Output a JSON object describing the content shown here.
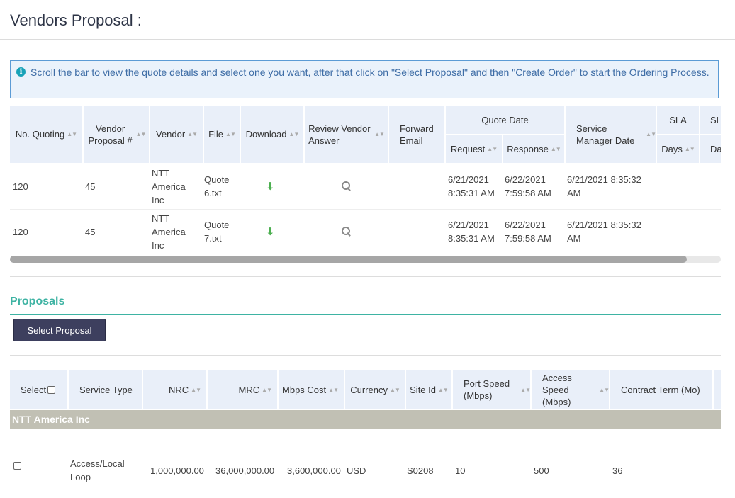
{
  "page": {
    "title": "Vendors Proposal :"
  },
  "info": {
    "icon": "info-icon",
    "message": "Scroll the bar to view the quote details and select one you want, after that click on \"Select Proposal\" and then \"Create Order\" to start the Ordering Process."
  },
  "quotes": {
    "headers": {
      "no_quoting": "No. Quoting",
      "vendor_proposal": "Vendor Proposal #",
      "vendor": "Vendor",
      "file": "File",
      "download": "Download",
      "review": "Review Vendor Answer",
      "forward_email": "Forward Email",
      "quote_date": "Quote Date",
      "request": "Request",
      "response": "Response",
      "service_manager_date": "Service Manager Date",
      "sla": "SLA",
      "sla_days": "Days",
      "sla2": "SL",
      "sla2_days": "Da"
    },
    "rows": [
      {
        "no_quoting": "120",
        "vendor_proposal": "45",
        "vendor": "NTT America Inc",
        "file": "Quote 6.txt",
        "request": "6/21/2021 8:35:31 AM",
        "response": "6/22/2021 7:59:58 AM",
        "service_manager_date": "6/21/2021 8:35:32 AM"
      },
      {
        "no_quoting": "120",
        "vendor_proposal": "45",
        "vendor": "NTT America Inc",
        "file": "Quote 7.txt",
        "request": "6/21/2021 8:35:31 AM",
        "response": "6/22/2021 7:59:58 AM",
        "service_manager_date": "6/21/2021 8:35:32 AM"
      }
    ]
  },
  "proposals": {
    "title": "Proposals",
    "select_button": "Select Proposal",
    "headers": {
      "select": "Select",
      "service_type": "Service Type",
      "nrc": "NRC",
      "mrc": "MRC",
      "mbps_cost": "Mbps Cost",
      "currency": "Currency",
      "site_id": "Site Id",
      "port_speed": "Port Speed (Mbps)",
      "access_speed": "Access Speed (Mbps)",
      "contract_term": "Contract Term (Mo)"
    },
    "group": "NTT America Inc",
    "rows": [
      {
        "service_type": "Access/Local Loop",
        "nrc": "1,000,000.00",
        "mrc": "36,000,000.00",
        "mbps_cost": "3,600,000.00",
        "currency": "USD",
        "site_id": "S0208",
        "port_speed": "10",
        "access_speed": "500",
        "contract_term": "36"
      }
    ]
  },
  "colors": {
    "header_bg": "#e9eff9",
    "accent_teal": "#3eb3a3",
    "button_bg": "#3d3f5e",
    "group_bg": "#c1c0b4",
    "download_green": "#4caf50"
  }
}
